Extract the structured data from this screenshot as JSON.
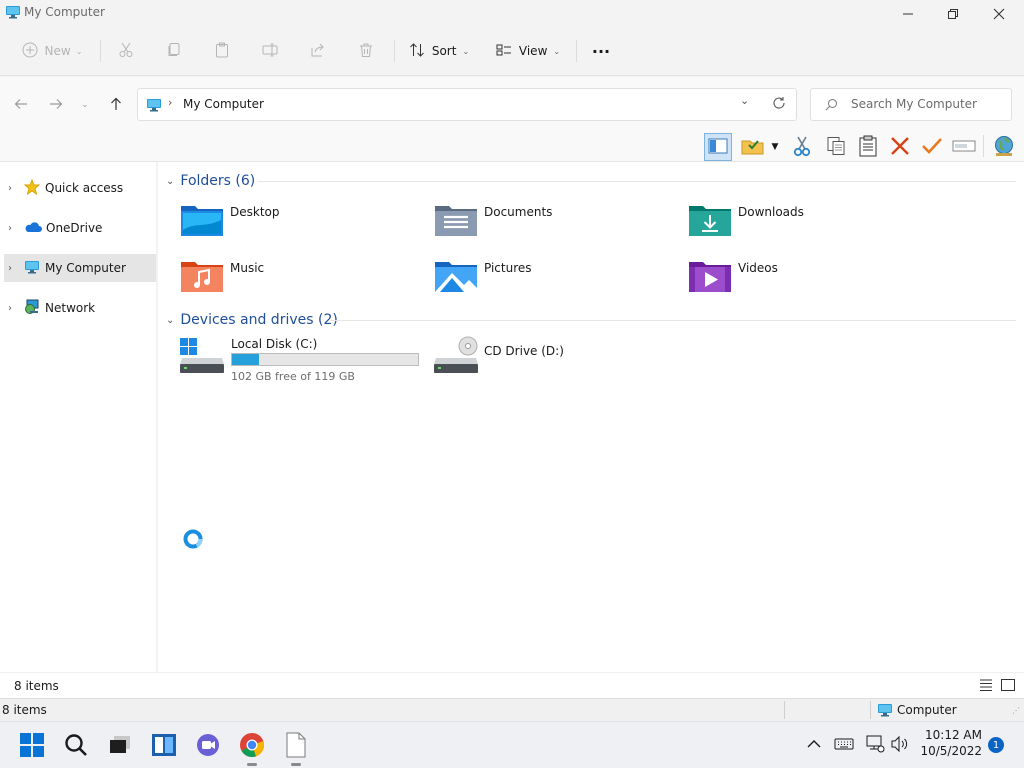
{
  "window": {
    "title": "My Computer"
  },
  "command_bar": {
    "new_label": "New",
    "sort_label": "Sort",
    "view_label": "View",
    "more_label": "···"
  },
  "address": {
    "path": "My Computer",
    "search_placeholder": "Search My Computer"
  },
  "nav": {
    "items": [
      {
        "label": "Quick access"
      },
      {
        "label": "OneDrive"
      },
      {
        "label": "My Computer"
      },
      {
        "label": "Network"
      }
    ]
  },
  "folders": {
    "header": "Folders (6)",
    "items": [
      {
        "label": "Desktop"
      },
      {
        "label": "Documents"
      },
      {
        "label": "Downloads"
      },
      {
        "label": "Music"
      },
      {
        "label": "Pictures"
      },
      {
        "label": "Videos"
      }
    ]
  },
  "devices": {
    "header": "Devices and drives (2)",
    "items": [
      {
        "label": "Local Disk (C:)",
        "free_text": "102 GB free of 119 GB",
        "used_fraction": 0.143
      },
      {
        "label": "CD Drive (D:)"
      }
    ]
  },
  "status": {
    "items_count": "8 items"
  },
  "legacy_status": {
    "items_count": "8 items",
    "zone": "Computer"
  },
  "taskbar": {
    "time": "10:12 AM",
    "date": "10/5/2022",
    "notification_count": "1"
  },
  "colors": {
    "accent": "#0078d4",
    "group_header": "#1f4f9a",
    "progress": "#26a0da"
  }
}
